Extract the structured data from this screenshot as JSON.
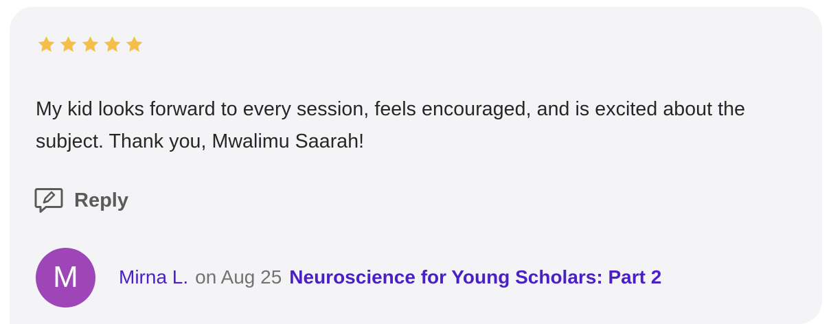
{
  "review": {
    "rating": 5,
    "rating_max": 5,
    "star_color": "#f5c04a",
    "text": "My kid looks forward to every session, feels encouraged, and is excited about the subject. Thank you, Mwalimu Saarah!",
    "reply_label": "Reply",
    "reply_icon": "comment-edit-icon"
  },
  "author": {
    "initial": "M",
    "avatar_color": "#9e45b8",
    "name": "Mirna L.",
    "date_text": "on Aug 25",
    "class_title": "Neuroscience for Young Scholars: Part 2"
  },
  "colors": {
    "card_background": "#f4f4f6",
    "link": "#4a1fc5",
    "body_text": "#262626",
    "muted_text": "#727272"
  }
}
